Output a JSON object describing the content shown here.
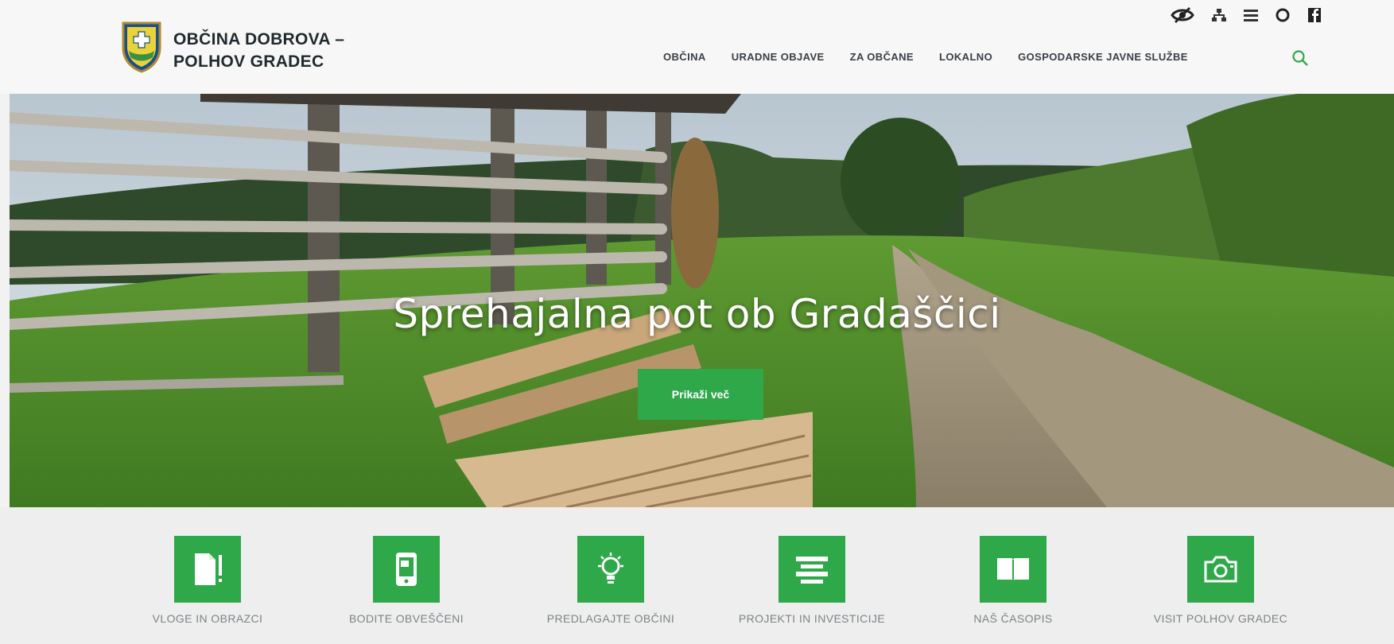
{
  "site": {
    "name_line1": "OBČINA DOBROVA –",
    "name_line2": "POLHOV GRADEC"
  },
  "nav": {
    "items": [
      {
        "label": "OBČINA"
      },
      {
        "label": "URADNE OBJAVE"
      },
      {
        "label": "ZA OBČANE"
      },
      {
        "label": "LOKALNO"
      },
      {
        "label": "GOSPODARSKE JAVNE SLUŽBE"
      }
    ],
    "search_icon": "search-icon"
  },
  "utility_icons": [
    "accessibility-eye-icon",
    "sitemap-icon",
    "menu-icon",
    "contrast-icon",
    "facebook-icon"
  ],
  "hero": {
    "title": "Sprehajalna pot ob Gradaščici",
    "button_label": "Prikaži več"
  },
  "quick_links": [
    {
      "label": "VLOGE IN OBRAZCI",
      "icon": "document-icon"
    },
    {
      "label": "BODITE OBVEŠČENI",
      "icon": "mobile-notification-icon"
    },
    {
      "label": "PREDLAGAJTE OBČINI",
      "icon": "lightbulb-icon"
    },
    {
      "label": "PROJEKTI IN INVESTICIJE",
      "icon": "projects-icon"
    },
    {
      "label": "NAŠ ČASOPIS",
      "icon": "book-icon"
    },
    {
      "label": "VISIT POLHOV GRADEC",
      "icon": "camera-icon"
    }
  ],
  "colors": {
    "accent_green": "#2fa84a",
    "text_dark": "#1f2a2e",
    "label_grey": "#7c8386"
  }
}
